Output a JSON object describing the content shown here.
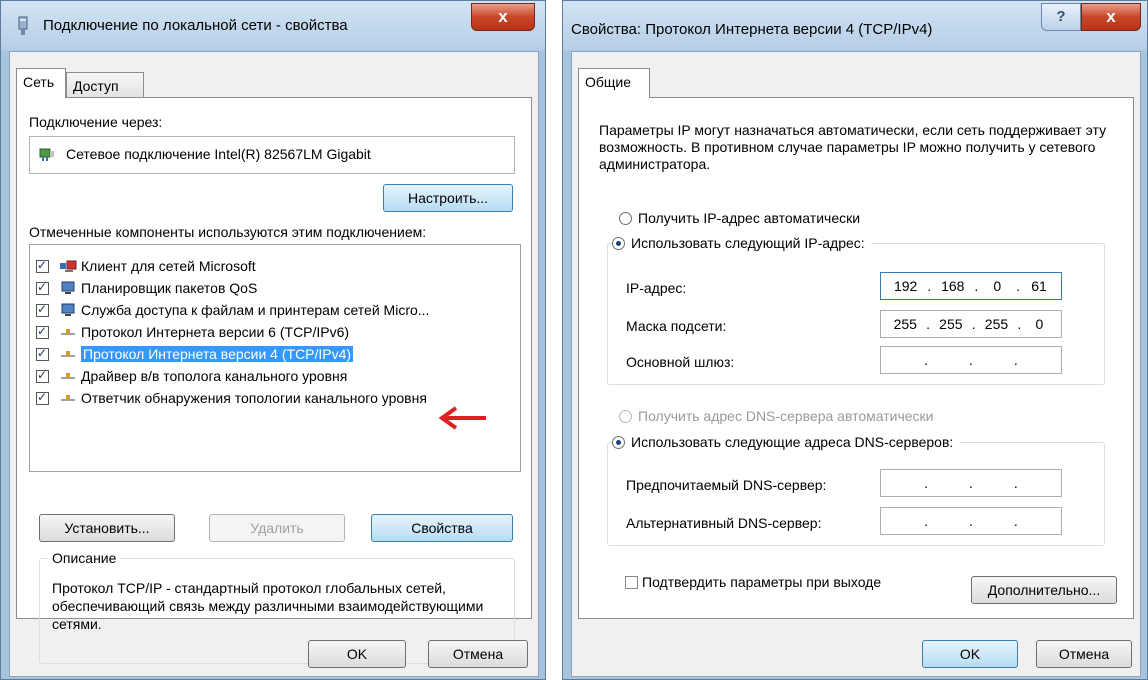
{
  "win1": {
    "title": "Подключение по локальной сети - свойства",
    "close": "x",
    "tabs": [
      {
        "label": "Сеть"
      },
      {
        "label": "Доступ"
      }
    ],
    "connect_via_label": "Подключение через:",
    "adapter_name": "Сетевое подключение Intel(R) 82567LM Gigabit",
    "configure_button": "Настроить...",
    "components_label": "Отмеченные компоненты используются этим подключением:",
    "components": [
      {
        "label": "Клиент для сетей Microsoft",
        "checked": true,
        "icon": "network-client-icon"
      },
      {
        "label": "Планировщик пакетов QoS",
        "checked": true,
        "icon": "computer-icon"
      },
      {
        "label": "Служба доступа к файлам и принтерам сетей Micro...",
        "checked": true,
        "icon": "computer-icon"
      },
      {
        "label": "Протокол Интернета версии 6 (TCP/IPv6)",
        "checked": true,
        "icon": "protocol-icon"
      },
      {
        "label": "Протокол Интернета версии 4 (TCP/IPv4)",
        "checked": true,
        "icon": "protocol-icon",
        "selected": true
      },
      {
        "label": "Драйвер в/в тополога канального уровня",
        "checked": true,
        "icon": "protocol-icon"
      },
      {
        "label": "Ответчик обнаружения топологии канального уровня",
        "checked": true,
        "icon": "protocol-icon"
      }
    ],
    "install_button": "Установить...",
    "remove_button": "Удалить",
    "properties_button": "Свойства",
    "description_title": "Описание",
    "description_text": "Протокол TCP/IP - стандартный протокол глобальных сетей, обеспечивающий связь между различными взаимодействующими сетями.",
    "ok_button": "OK",
    "cancel_button": "Отмена"
  },
  "win2": {
    "title": "Свойства: Протокол Интернета версии 4 (TCP/IPv4)",
    "help": "?",
    "close": "x",
    "tab": "Общие",
    "intro": "Параметры IP могут назначаться автоматически, если сеть поддерживает эту возможность. В противном случае параметры IP можно получить у сетевого администратора.",
    "ip_auto": "Получить IP-адрес автоматически",
    "ip_manual": "Использовать следующий IP-адрес:",
    "ip_label": "IP-адрес:",
    "ip_value": [
      "192",
      "168",
      "0",
      "61"
    ],
    "mask_label": "Маска подсети:",
    "mask_value": [
      "255",
      "255",
      "255",
      "0"
    ],
    "gateway_label": "Основной шлюз:",
    "dns_auto": "Получить адрес DNS-сервера автоматически",
    "dns_manual": "Использовать следующие адреса DNS-серверов:",
    "dns_pref_label": "Предпочитаемый DNS-сервер:",
    "dns_alt_label": "Альтернативный DNS-сервер:",
    "validate_label": "Подтвердить параметры при выходе",
    "advanced_button": "Дополнительно...",
    "ok_button": "OK",
    "cancel_button": "Отмена"
  },
  "colors": {
    "selection": "#3399ff",
    "arrow": "#e02020",
    "close": "#c7462a"
  }
}
